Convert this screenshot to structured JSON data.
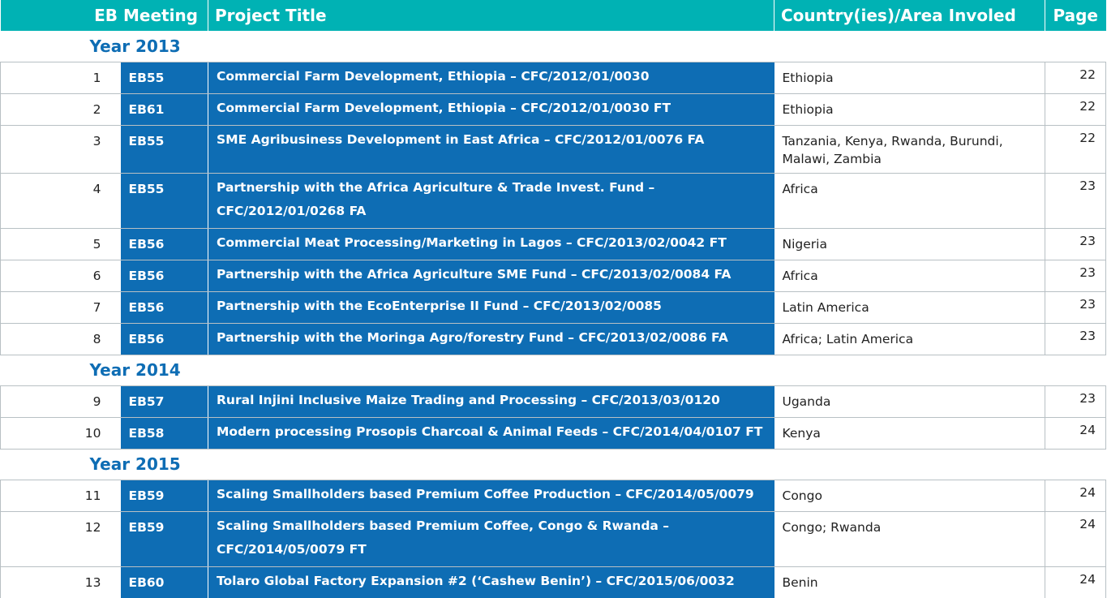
{
  "header": {
    "eb_meeting": "EB Meeting",
    "project_title": "Project Title",
    "country": "Country(ies)/Area Involed",
    "page": "Page"
  },
  "sections": [
    {
      "year": "Year 2013",
      "rows": [
        {
          "num": "1",
          "eb": "EB55",
          "title": "Commercial Farm Development, Ethiopia – CFC/2012/01/0030",
          "country": "Ethiopia",
          "page": "22"
        },
        {
          "num": "2",
          "eb": "EB61",
          "title": "Commercial Farm Development, Ethiopia – CFC/2012/01/0030 FT",
          "country": "Ethiopia",
          "page": "22"
        },
        {
          "num": "3",
          "eb": "EB55",
          "title": "SME Agribusiness Development in East Africa – CFC/2012/01/0076 FA",
          "country": "Tanzania, Kenya, Rwanda, Burundi, Malawi, Zambia",
          "page": "22"
        },
        {
          "num": "4",
          "eb": "EB55",
          "title": "Partnership with the Africa Agriculture & Trade Invest. Fund – CFC/2012/01/0268 FA",
          "country": "Africa",
          "page": "23"
        },
        {
          "num": "5",
          "eb": "EB56",
          "title": "Commercial Meat Processing/Marketing in Lagos – CFC/2013/02/0042 FT",
          "country": "Nigeria",
          "page": "23"
        },
        {
          "num": "6",
          "eb": "EB56",
          "title": "Partnership with the Africa Agriculture SME Fund – CFC/2013/02/0084 FA",
          "country": "Africa",
          "page": "23"
        },
        {
          "num": "7",
          "eb": "EB56",
          "title": "Partnership with the EcoEnterprise II Fund – CFC/2013/02/0085",
          "country": "Latin America",
          "page": "23"
        },
        {
          "num": "8",
          "eb": "EB56",
          "title": "Partnership with the Moringa Agro/forestry Fund – CFC/2013/02/0086 FA",
          "country": "Africa; Latin America",
          "page": "23"
        }
      ]
    },
    {
      "year": "Year 2014",
      "rows": [
        {
          "num": "9",
          "eb": "EB57",
          "title": "Rural Injini Inclusive Maize Trading and Processing – CFC/2013/03/0120",
          "country": "Uganda",
          "page": "23"
        },
        {
          "num": "10",
          "eb": "EB58",
          "title": "Modern processing Prosopis Charcoal & Animal Feeds – CFC/2014/04/0107 FT",
          "country": "Kenya",
          "page": "24"
        }
      ]
    },
    {
      "year": "Year 2015",
      "rows": [
        {
          "num": "11",
          "eb": "EB59",
          "title": "Scaling Smallholders based Premium Coffee Production – CFC/2014/05/0079",
          "country": "Congo",
          "page": "24"
        },
        {
          "num": "12",
          "eb": "EB59",
          "title": "Scaling Smallholders based Premium Coffee, Congo & Rwanda – CFC/2014/05/0079 FT",
          "country": "Congo; Rwanda",
          "page": "24"
        },
        {
          "num": "13",
          "eb": "EB60",
          "title": "Tolaro Global Factory Expansion #2 (‘Cashew Benin’) – CFC/2015/06/0032",
          "country": "Benin",
          "page": "24"
        }
      ]
    }
  ]
}
